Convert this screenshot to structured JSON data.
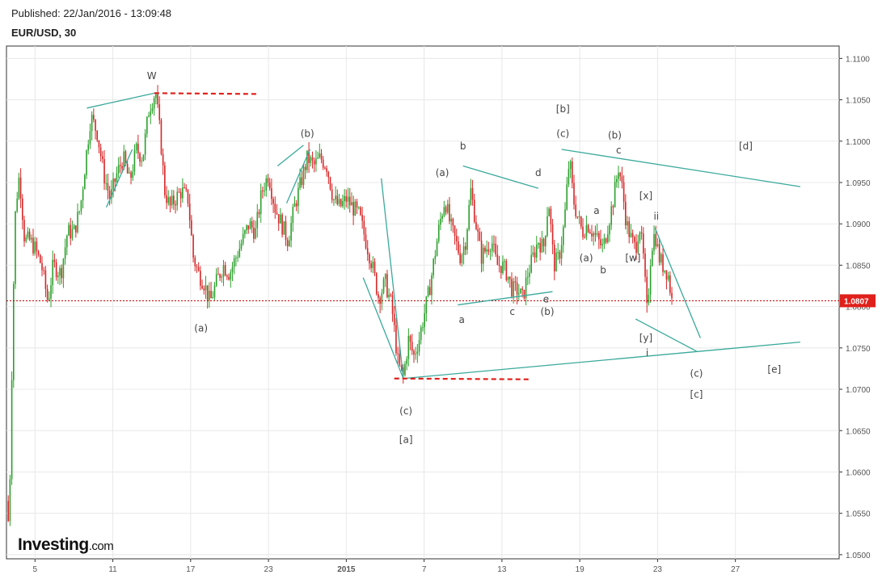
{
  "header": {
    "published": "Published: 22/Jan/2016 - 13:09:48",
    "symbol": "EUR/USD, 30"
  },
  "logo": {
    "main": "Investing",
    "suffix": ".com"
  },
  "colors": {
    "up_candle": "#2ca02c",
    "down_candle": "#d62728",
    "trendline": "#3aa99b",
    "resistance_dash": "#e0201b",
    "current_price_line": "#cc0000",
    "price_tag_bg": "#e0201b",
    "grid": "#e8e8e8",
    "axis": "#333333"
  },
  "chart_data": {
    "type": "candlestick",
    "title": "EUR/USD, 30",
    "xlabel": "",
    "ylabel": "",
    "ylim": [
      1.0495,
      1.1115
    ],
    "y_ticks": [
      "1.1100",
      "1.1050",
      "1.1000",
      "1.0950",
      "1.0900",
      "1.0850",
      "1.0800",
      "1.0750",
      "1.0700",
      "1.0650",
      "1.0600",
      "1.0550",
      "1.0500"
    ],
    "x_ticks": [
      {
        "label": "5",
        "x": 5
      },
      {
        "label": "11",
        "x": 11
      },
      {
        "label": "17",
        "x": 17
      },
      {
        "label": "23",
        "x": 23
      },
      {
        "label": "2015",
        "x": 29,
        "bold": true
      },
      {
        "label": "7",
        "x": 35
      },
      {
        "label": "13",
        "x": 41
      },
      {
        "label": "19",
        "x": 47
      },
      {
        "label": "23",
        "x": 53
      },
      {
        "label": "27",
        "x": 59
      }
    ],
    "xlim": [
      2.8,
      67
    ],
    "current_price": 1.0807,
    "current_price_label": "1.0807",
    "grid": true,
    "price_path": [
      [
        2.8,
        1.0565
      ],
      [
        3.0,
        1.053
      ],
      [
        3.3,
        1.08
      ],
      [
        3.5,
        1.092
      ],
      [
        3.8,
        1.096
      ],
      [
        4.2,
        1.088
      ],
      [
        4.6,
        1.088
      ],
      [
        5.0,
        1.087
      ],
      [
        5.5,
        1.085
      ],
      [
        6.0,
        1.0805
      ],
      [
        6.4,
        1.085
      ],
      [
        7.0,
        1.084
      ],
      [
        7.5,
        1.089
      ],
      [
        8.0,
        1.089
      ],
      [
        8.5,
        1.092
      ],
      [
        9.0,
        1.099
      ],
      [
        9.3,
        1.103
      ],
      [
        9.8,
        1.101
      ],
      [
        10.3,
        1.096
      ],
      [
        10.8,
        1.093
      ],
      [
        11.3,
        1.096
      ],
      [
        11.8,
        1.098
      ],
      [
        12.3,
        1.095
      ],
      [
        12.8,
        1.099
      ],
      [
        13.3,
        1.098
      ],
      [
        13.8,
        1.104
      ],
      [
        14.3,
        1.106
      ],
      [
        14.7,
        1.1
      ],
      [
        15.0,
        1.094
      ],
      [
        15.4,
        1.092
      ],
      [
        15.8,
        1.093
      ],
      [
        16.3,
        1.094
      ],
      [
        16.8,
        1.093
      ],
      [
        17.2,
        1.086
      ],
      [
        17.6,
        1.084
      ],
      [
        18.0,
        1.083
      ],
      [
        18.5,
        1.0805
      ],
      [
        19.0,
        1.083
      ],
      [
        19.5,
        1.085
      ],
      [
        20.0,
        1.084
      ],
      [
        20.5,
        1.086
      ],
      [
        21.0,
        1.088
      ],
      [
        21.5,
        1.09
      ],
      [
        22.0,
        1.089
      ],
      [
        22.5,
        1.094
      ],
      [
        23.0,
        1.096
      ],
      [
        23.5,
        1.092
      ],
      [
        24.0,
        1.09
      ],
      [
        24.5,
        1.088
      ],
      [
        25.0,
        1.092
      ],
      [
        25.5,
        1.095
      ],
      [
        26.0,
        1.098
      ],
      [
        26.5,
        1.097
      ],
      [
        27.0,
        1.098
      ],
      [
        27.5,
        1.097
      ],
      [
        28.0,
        1.093
      ],
      [
        28.5,
        1.092
      ],
      [
        29.0,
        1.093
      ],
      [
        29.5,
        1.092
      ],
      [
        30.0,
        1.091
      ],
      [
        30.5,
        1.088
      ],
      [
        31.0,
        1.085
      ],
      [
        31.5,
        1.081
      ],
      [
        32.0,
        1.083
      ],
      [
        32.5,
        1.08
      ],
      [
        33.0,
        1.073
      ],
      [
        33.4,
        1.0715
      ],
      [
        33.8,
        1.076
      ],
      [
        34.2,
        1.074
      ],
      [
        34.6,
        1.076
      ],
      [
        35.0,
        1.079
      ],
      [
        35.4,
        1.082
      ],
      [
        35.8,
        1.086
      ],
      [
        36.2,
        1.09
      ],
      [
        36.6,
        1.093
      ],
      [
        37.0,
        1.09
      ],
      [
        37.4,
        1.088
      ],
      [
        37.8,
        1.086
      ],
      [
        38.2,
        1.088
      ],
      [
        38.6,
        1.094
      ],
      [
        39.0,
        1.09
      ],
      [
        39.4,
        1.086
      ],
      [
        39.8,
        1.087
      ],
      [
        40.2,
        1.088
      ],
      [
        40.6,
        1.085
      ],
      [
        41.0,
        1.085
      ],
      [
        41.4,
        1.084
      ],
      [
        41.8,
        1.082
      ],
      [
        42.2,
        1.082
      ],
      [
        42.6,
        1.081
      ],
      [
        43.0,
        1.084
      ],
      [
        43.4,
        1.086
      ],
      [
        43.8,
        1.088
      ],
      [
        44.2,
        1.087
      ],
      [
        44.6,
        1.093
      ],
      [
        45.0,
        1.085
      ],
      [
        45.4,
        1.086
      ],
      [
        45.8,
        1.09
      ],
      [
        46.2,
        1.098
      ],
      [
        46.5,
        1.093
      ],
      [
        46.8,
        1.091
      ],
      [
        47.2,
        1.089
      ],
      [
        47.6,
        1.09
      ],
      [
        48.0,
        1.089
      ],
      [
        48.4,
        1.088
      ],
      [
        48.8,
        1.087
      ],
      [
        49.2,
        1.09
      ],
      [
        49.6,
        1.093
      ],
      [
        50.0,
        1.097
      ],
      [
        50.3,
        1.094
      ],
      [
        50.6,
        1.09
      ],
      [
        51.0,
        1.088
      ],
      [
        51.3,
        1.087
      ],
      [
        51.6,
        1.09
      ],
      [
        51.9,
        1.086
      ],
      [
        52.2,
        1.079
      ],
      [
        52.5,
        1.087
      ],
      [
        52.8,
        1.089
      ],
      [
        53.1,
        1.086
      ],
      [
        53.4,
        1.085
      ],
      [
        53.8,
        1.084
      ],
      [
        54.1,
        1.0807
      ]
    ],
    "annotations": [
      {
        "text": "W",
        "x": 14.0,
        "y": 1.1075
      },
      {
        "text": "(a)",
        "x": 17.8,
        "y": 1.077
      },
      {
        "text": "(b)",
        "x": 26.0,
        "y": 1.1005
      },
      {
        "text": "(c)",
        "x": 33.6,
        "y": 1.067
      },
      {
        "text": "[a]",
        "x": 33.6,
        "y": 1.0635
      },
      {
        "text": "(a)",
        "x": 36.4,
        "y": 1.0958
      },
      {
        "text": "b",
        "x": 38.0,
        "y": 1.099
      },
      {
        "text": "a",
        "x": 37.9,
        "y": 1.078
      },
      {
        "text": "c",
        "x": 41.8,
        "y": 1.079
      },
      {
        "text": "d",
        "x": 43.8,
        "y": 1.0958
      },
      {
        "text": "e",
        "x": 44.4,
        "y": 1.0805
      },
      {
        "text": "(b)",
        "x": 44.5,
        "y": 1.079
      },
      {
        "text": "[b]",
        "x": 45.7,
        "y": 1.1035
      },
      {
        "text": "(c)",
        "x": 45.7,
        "y": 1.1005
      },
      {
        "text": "(b)",
        "x": 49.7,
        "y": 1.1003
      },
      {
        "text": "c",
        "x": 50.0,
        "y": 1.0985
      },
      {
        "text": "a",
        "x": 48.3,
        "y": 1.0912
      },
      {
        "text": "(a)",
        "x": 47.5,
        "y": 1.0855
      },
      {
        "text": "b",
        "x": 48.8,
        "y": 1.084
      },
      {
        "text": "[x]",
        "x": 52.1,
        "y": 1.093
      },
      {
        "text": "ii",
        "x": 52.9,
        "y": 1.0905
      },
      {
        "text": "[w]",
        "x": 51.1,
        "y": 1.0855
      },
      {
        "text": "[y]",
        "x": 52.1,
        "y": 1.0758
      },
      {
        "text": "i",
        "x": 52.2,
        "y": 1.074
      },
      {
        "text": "[d]",
        "x": 59.8,
        "y": 1.099
      },
      {
        "text": "(c)",
        "x": 56.0,
        "y": 1.0715
      },
      {
        "text": "[c]",
        "x": 56.0,
        "y": 1.069
      },
      {
        "text": "[e]",
        "x": 62.0,
        "y": 1.072
      }
    ],
    "trendlines": [
      [
        [
          9.0,
          1.104
        ],
        [
          14.2,
          1.1058
        ]
      ],
      [
        [
          10.5,
          1.092
        ],
        [
          12.5,
          1.099
        ]
      ],
      [
        [
          23.7,
          1.097
        ],
        [
          25.7,
          1.0995
        ]
      ],
      [
        [
          24.4,
          1.0925
        ],
        [
          26.2,
          1.099
        ]
      ],
      [
        [
          31.7,
          1.0955
        ],
        [
          33.4,
          1.0713
        ]
      ],
      [
        [
          30.3,
          1.0835
        ],
        [
          33.4,
          1.0713
        ]
      ],
      [
        [
          33.4,
          1.0713
        ],
        [
          64.0,
          1.0757
        ]
      ],
      [
        [
          38.0,
          1.097
        ],
        [
          43.8,
          1.0943
        ]
      ],
      [
        [
          37.6,
          1.0802
        ],
        [
          44.9,
          1.0818
        ]
      ],
      [
        [
          45.6,
          1.099
        ],
        [
          64.0,
          1.0945
        ]
      ],
      [
        [
          52.8,
          1.0895
        ],
        [
          56.3,
          1.0762
        ]
      ],
      [
        [
          51.3,
          1.0785
        ],
        [
          56.0,
          1.0746
        ]
      ]
    ],
    "resistance_lines": [
      [
        [
          14.2,
          1.1058
        ],
        [
          22.3,
          1.1057
        ]
      ],
      [
        [
          32.7,
          1.0713
        ],
        [
          43.2,
          1.0712
        ]
      ]
    ]
  }
}
